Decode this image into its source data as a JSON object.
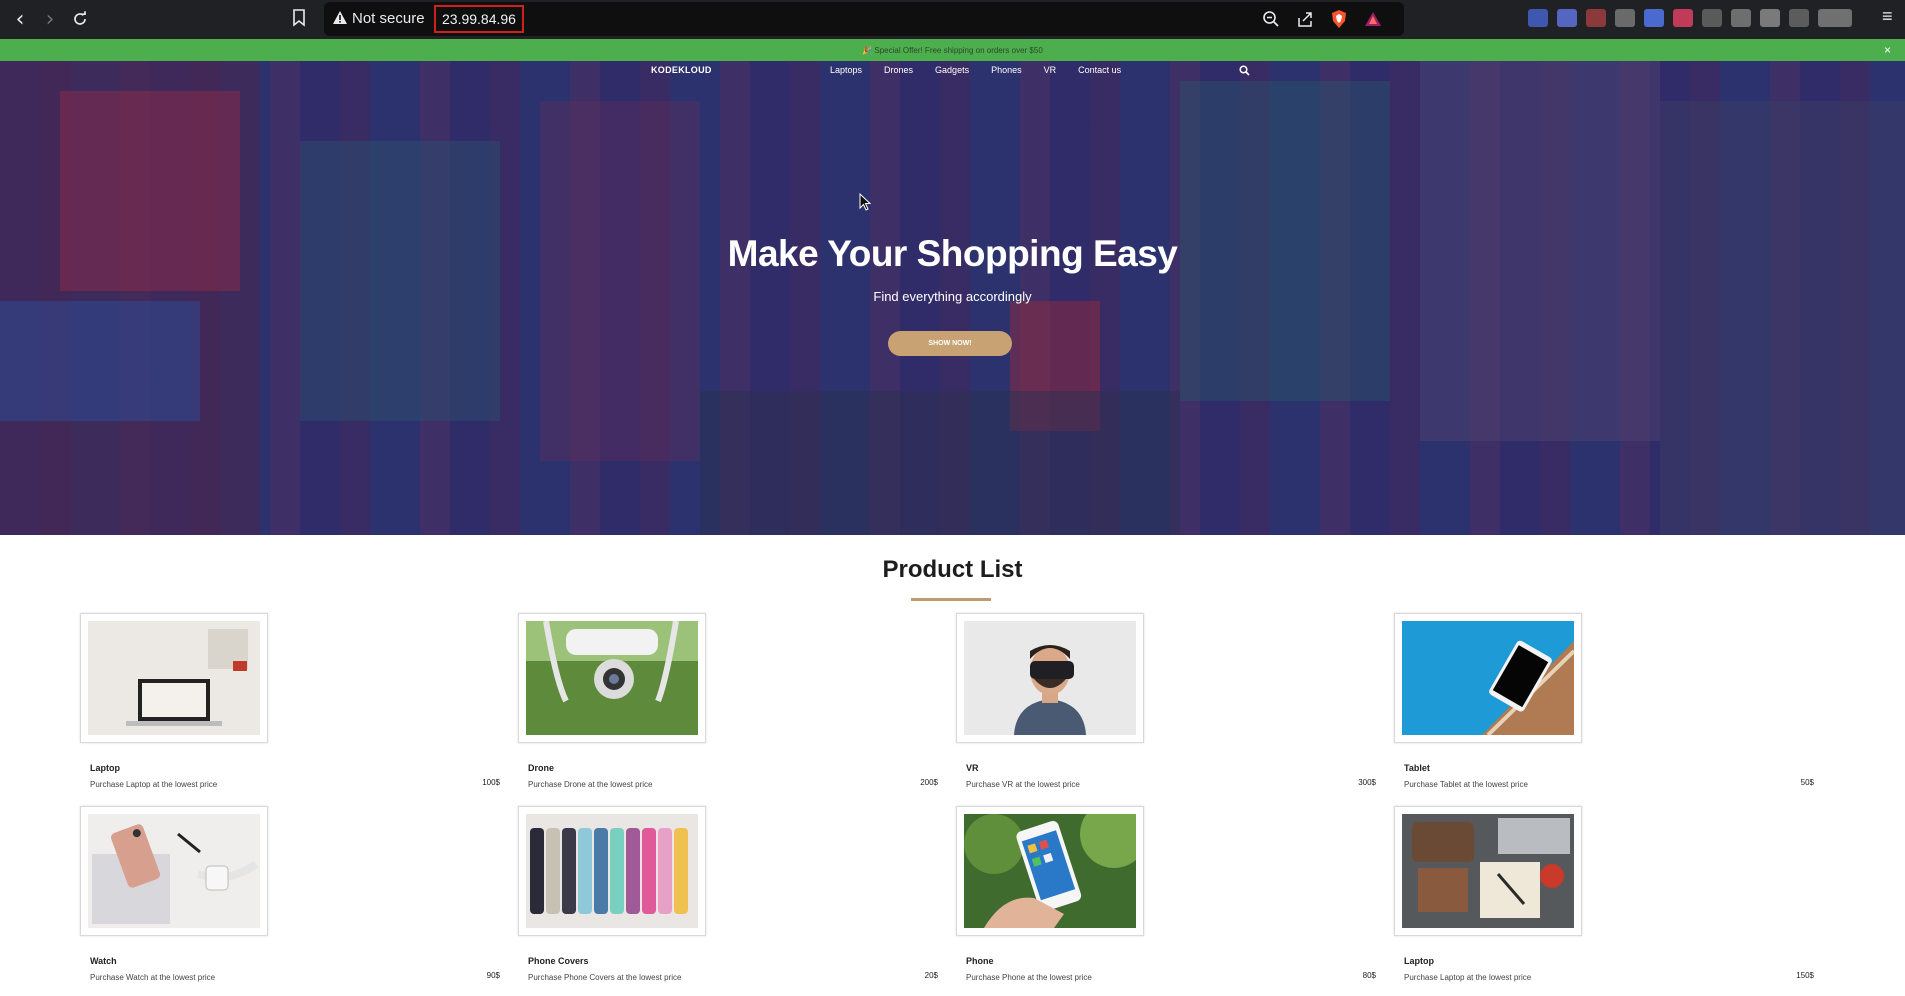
{
  "browser": {
    "security_label": "Not secure",
    "url": "23.99.84.96"
  },
  "promo": {
    "text": "🎉 Special Offer! Free shipping on orders over $50",
    "close": "×"
  },
  "header": {
    "brand": "KODEKLOUD",
    "nav": [
      "Laptops",
      "Drones",
      "Gadgets",
      "Phones",
      "VR",
      "Contact us"
    ]
  },
  "hero": {
    "title": "Make Your Shopping Easy",
    "subtitle": "Find everything accordingly",
    "button": "SHOW NOW!"
  },
  "products": {
    "title": "Product List",
    "items": [
      {
        "name": "Laptop",
        "desc": "Purchase Laptop at the lowest price",
        "price": "100$",
        "image": "laptop-photo"
      },
      {
        "name": "Drone",
        "desc": "Purchase Drone at the lowest price",
        "price": "200$",
        "image": "drone-photo"
      },
      {
        "name": "VR",
        "desc": "Purchase VR at the lowest price",
        "price": "300$",
        "image": "vr-photo"
      },
      {
        "name": "Tablet",
        "desc": "Purchase Tablet at the lowest price",
        "price": "50$",
        "image": "tablet-photo"
      },
      {
        "name": "Watch",
        "desc": "Purchase Watch at the lowest price",
        "price": "90$",
        "image": "watch-photo"
      },
      {
        "name": "Phone Covers",
        "desc": "Purchase Phone Covers at the lowest price",
        "price": "20$",
        "image": "phone-covers-photo"
      },
      {
        "name": "Phone",
        "desc": "Purchase Phone at the lowest price",
        "price": "80$",
        "image": "phone-photo"
      },
      {
        "name": "Laptop",
        "desc": "Purchase Laptop at the lowest price",
        "price": "150$",
        "image": "laptop-desk-photo"
      }
    ]
  },
  "colors": {
    "promo_bg": "#4cae4c",
    "accent": "#c8a272",
    "browser_bg": "#202124"
  }
}
